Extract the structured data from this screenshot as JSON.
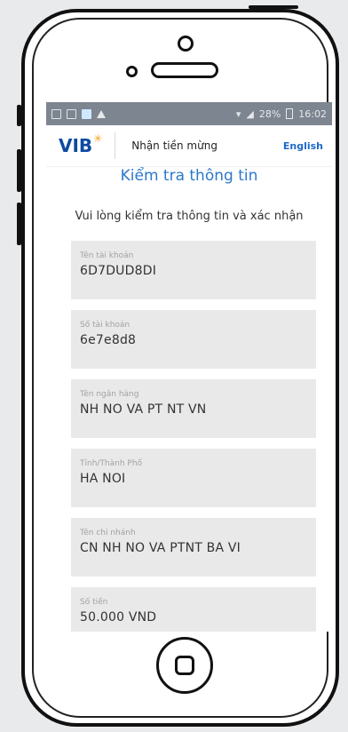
{
  "status_bar": {
    "battery": "28%",
    "time": "16:02"
  },
  "header": {
    "logo": "VIB",
    "title": "Nhận tiền mừng",
    "language": "English"
  },
  "page": {
    "title": "Kiểm tra thông tin",
    "instruction": "Vui lòng kiểm tra thông tin và xác nhận"
  },
  "fields": [
    {
      "label": "Tên tài khoản",
      "value": "6D7DUD8DI"
    },
    {
      "label": "Số tài khoản",
      "value": "6e7e8d8"
    },
    {
      "label": "Tên ngân hàng",
      "value": "NH NO VA PT NT VN"
    },
    {
      "label": "Tỉnh/Thành Phố",
      "value": "HA NOI"
    },
    {
      "label": "Tên chi nhánh",
      "value": "CN NH NO VA PTNT BA VI"
    },
    {
      "label": "Số tiền",
      "value": "50.000 VND"
    }
  ],
  "colors": {
    "brand": "#0d4aa0",
    "accent": "#2c78c9",
    "logo_star": "#f5a623"
  }
}
